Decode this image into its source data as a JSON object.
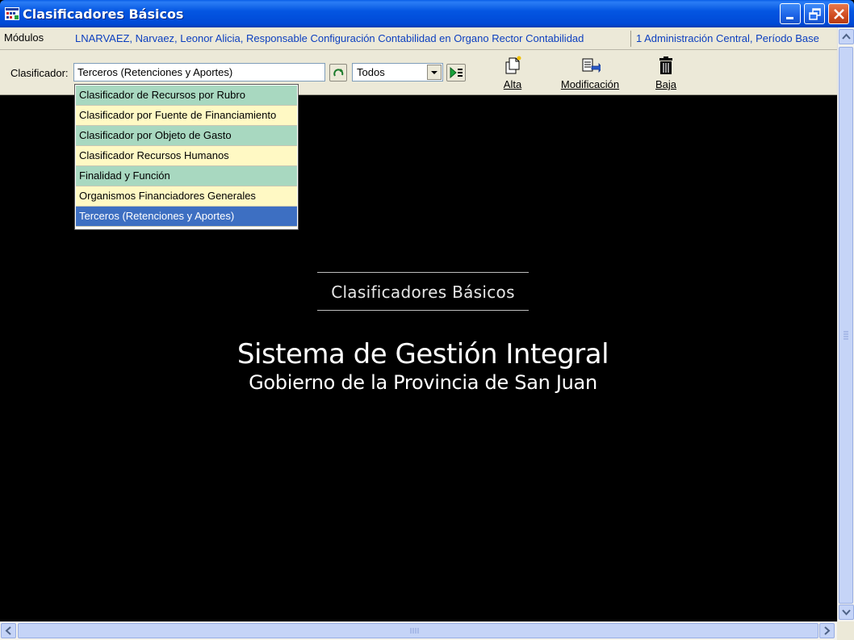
{
  "window": {
    "title": "Clasificadores Básicos",
    "icon": "app-grid-icon",
    "buttons": [
      "minimize-icon",
      "restore-icon",
      "close-icon"
    ]
  },
  "infobar": {
    "modulos": "Módulos",
    "user": "LNARVAEZ, Narvaez, Leonor Alicia, Responsable Configuración Contabilidad en Organo Rector Contabilidad",
    "admin": "1 Administración Central, Período Base"
  },
  "toolbar": {
    "clasificador_label": "Clasificador:",
    "clasificador_value": "Terceros (Retenciones y Aportes)",
    "filter_value": "Todos",
    "alta": "Alta",
    "modificacion": "Modificación",
    "baja": "Baja"
  },
  "dropdown": {
    "items": [
      "Clasificador de Recursos por Rubro",
      "Clasificador por Fuente de Financiamiento",
      "Clasificador por Objeto de Gasto",
      "Clasificador Recursos Humanos",
      "Finalidad y Función",
      "Organismos Financiadores Generales",
      "Terceros (Retenciones y Aportes)"
    ],
    "selected_index": 6
  },
  "splash": {
    "module": "Clasificadores Básicos",
    "system": "Sistema de Gestión Integral",
    "government": "Gobierno de la Provincia de San Juan"
  },
  "colors": {
    "titlebar": "#0456e2",
    "link_text": "#0c3fbf",
    "item_green": "#a8d8c0",
    "item_yellow": "#fff9c4",
    "item_selected": "#3d6fc2"
  }
}
